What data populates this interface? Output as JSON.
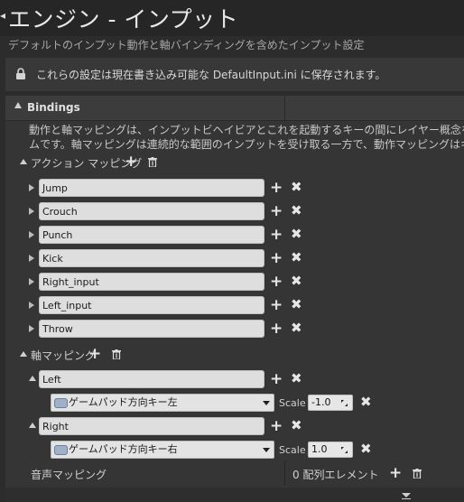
{
  "header": {
    "title": "エンジン - インプット",
    "subtitle": "デフォルトのインプット動作と軸バインディングを含めたインプット設定"
  },
  "notice": {
    "text": "これらの設定は現在書き込み可能な DefaultInput.ini に保存されます。"
  },
  "bindings": {
    "title": "Bindings",
    "description_line1": "動作と軸マッピングは、インプットビヘイビアとこれを起動するキーの間にレイヤー概念を挿入することに",
    "description_line2": "ムです。軸マッピングは連続的な範囲のインプットを受け取る一方で、動作マッピングはキーを押したり離",
    "action_mappings": {
      "label": "アクション マッピング",
      "items": [
        "Jump",
        "Crouch",
        "Punch",
        "Kick",
        "Right_input",
        "Left_input",
        "Throw"
      ]
    },
    "axis_mappings": {
      "label": "軸マッピング",
      "items": [
        {
          "name": "Left",
          "key": "ゲームパッド方向キー左",
          "scale_label": "Scale",
          "scale": "-1.0"
        },
        {
          "name": "Right",
          "key": "ゲームパッド方向キー右",
          "scale_label": "Scale",
          "scale": "1.0"
        }
      ]
    },
    "speech_mappings": {
      "label": "音声マッピング",
      "count_text": "0 配列エレメント"
    }
  },
  "colors": {
    "background": "#2c2c2c",
    "panel": "#353535",
    "field": "#dedede"
  }
}
